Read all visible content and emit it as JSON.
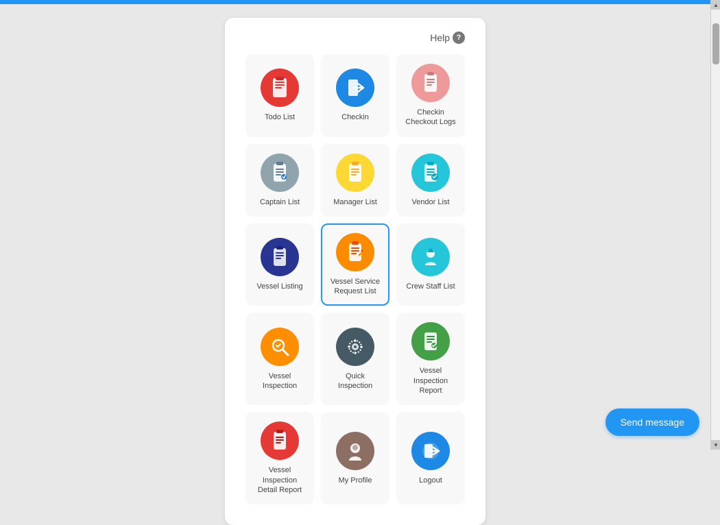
{
  "topbar": {
    "color": "#2196F3"
  },
  "help": {
    "label": "Help",
    "icon": "?"
  },
  "grid_items": [
    {
      "id": "todo-list",
      "label": "Todo List",
      "icon_bg": "#e53935",
      "icon_type": "clipboard-red",
      "active": false
    },
    {
      "id": "checkin",
      "label": "Checkin",
      "icon_bg": "#1E88E5",
      "icon_type": "door-blue",
      "active": false
    },
    {
      "id": "checkin-checkout-logs",
      "label": "Checkin Checkout Logs",
      "icon_bg": "#EF9A9A",
      "icon_type": "clipboard-salmon",
      "active": false
    },
    {
      "id": "captain-list",
      "label": "Captain List",
      "icon_bg": "#90A4AE",
      "icon_type": "clipboard-gray",
      "active": false
    },
    {
      "id": "manager-list",
      "label": "Manager List",
      "icon_bg": "#FDD835",
      "icon_type": "clipboard-yellow",
      "active": false
    },
    {
      "id": "vendor-list",
      "label": "Vendor List",
      "icon_bg": "#26C6DA",
      "icon_type": "clipboard-teal",
      "active": false
    },
    {
      "id": "vessel-listing",
      "label": "Vessel Listing",
      "icon_bg": "#1A237E",
      "icon_type": "clipboard-darkblue",
      "active": false
    },
    {
      "id": "vessel-service-request-list",
      "label": "Vessel Service Request List",
      "icon_bg": "#FB8C00",
      "icon_type": "clipboard-orange",
      "active": true
    },
    {
      "id": "crew-staff-list",
      "label": "Crew Staff List",
      "icon_bg": "#26C6DA",
      "icon_type": "person-teal",
      "active": false
    },
    {
      "id": "vessel-inspection",
      "label": "Vessel Inspection",
      "icon_bg": "#F57C00",
      "icon_type": "search-orange",
      "active": false
    },
    {
      "id": "quick-inspection",
      "label": "Quick Inspection",
      "icon_bg": "#37474F",
      "icon_type": "gear-dark",
      "active": false
    },
    {
      "id": "vessel-inspection-report",
      "label": "Vessel Inspection Report",
      "icon_bg": "#43A047",
      "icon_type": "report-green",
      "active": false
    },
    {
      "id": "vessel-inspection-detail-report",
      "label": "Vessel Inspection Detail Report",
      "icon_bg": "#E53935",
      "icon_type": "clipboard-red2",
      "active": false
    },
    {
      "id": "my-profile",
      "label": "My Profile",
      "icon_bg": "#8D6E63",
      "icon_type": "person-brown",
      "active": false
    },
    {
      "id": "logout",
      "label": "Logout",
      "icon_bg": "#1E88E5",
      "icon_type": "logout-blue",
      "active": false
    }
  ],
  "send_message_btn": "Send message"
}
